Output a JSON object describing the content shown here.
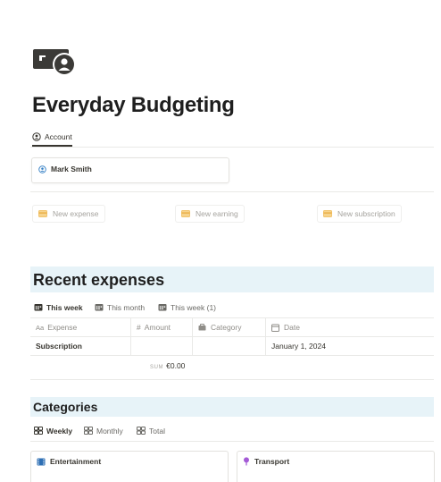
{
  "page": {
    "icon": "banknote-icon",
    "title": "Everyday Budgeting"
  },
  "tabs": [
    {
      "label": "Account",
      "icon": "user-circle-icon",
      "active": true
    }
  ],
  "account": {
    "name": "Mark Smith",
    "icon": "user-circle-icon"
  },
  "actions": [
    {
      "label": "New expense",
      "icon": "card-icon"
    },
    {
      "label": "New earning",
      "icon": "card-icon"
    },
    {
      "label": "New subscription",
      "icon": "card-icon"
    }
  ],
  "recent_expenses": {
    "title": "Recent expenses",
    "views": [
      {
        "label": "This week",
        "icon": "calendar-icon",
        "active": true
      },
      {
        "label": "This month",
        "icon": "calendar-icon",
        "active": false
      },
      {
        "label": "This week (1)",
        "icon": "calendar-icon",
        "active": false
      }
    ],
    "columns": [
      {
        "prefix": "Aa",
        "label": "Expense"
      },
      {
        "prefix": "#",
        "label": "Amount"
      },
      {
        "prefix": "",
        "label": "Category",
        "icon": "tag-icon"
      },
      {
        "prefix": "",
        "label": "Date",
        "icon": "calendar-outline-icon"
      }
    ],
    "rows": [
      {
        "expense": "Subscription",
        "amount": "",
        "category": "",
        "date": "January 1, 2024"
      }
    ],
    "sum_label": "SUM",
    "sum_value": "€0.00"
  },
  "categories": {
    "title": "Categories",
    "views": [
      {
        "label": "Weekly",
        "icon": "grid-icon",
        "active": true
      },
      {
        "label": "Monthly",
        "icon": "grid-icon",
        "active": false
      },
      {
        "label": "Total",
        "icon": "grid-icon",
        "active": false
      }
    ],
    "cards": [
      {
        "label": "Entertainment",
        "icon": "film-icon",
        "color": "#2e6fb4"
      },
      {
        "label": "Transport",
        "icon": "pin-icon",
        "color": "#a45bd6"
      }
    ]
  },
  "colors": {
    "section_bg": "#e7f3f8",
    "action_icon": "#f2c46d",
    "account_icon": "#2e7cc3"
  }
}
